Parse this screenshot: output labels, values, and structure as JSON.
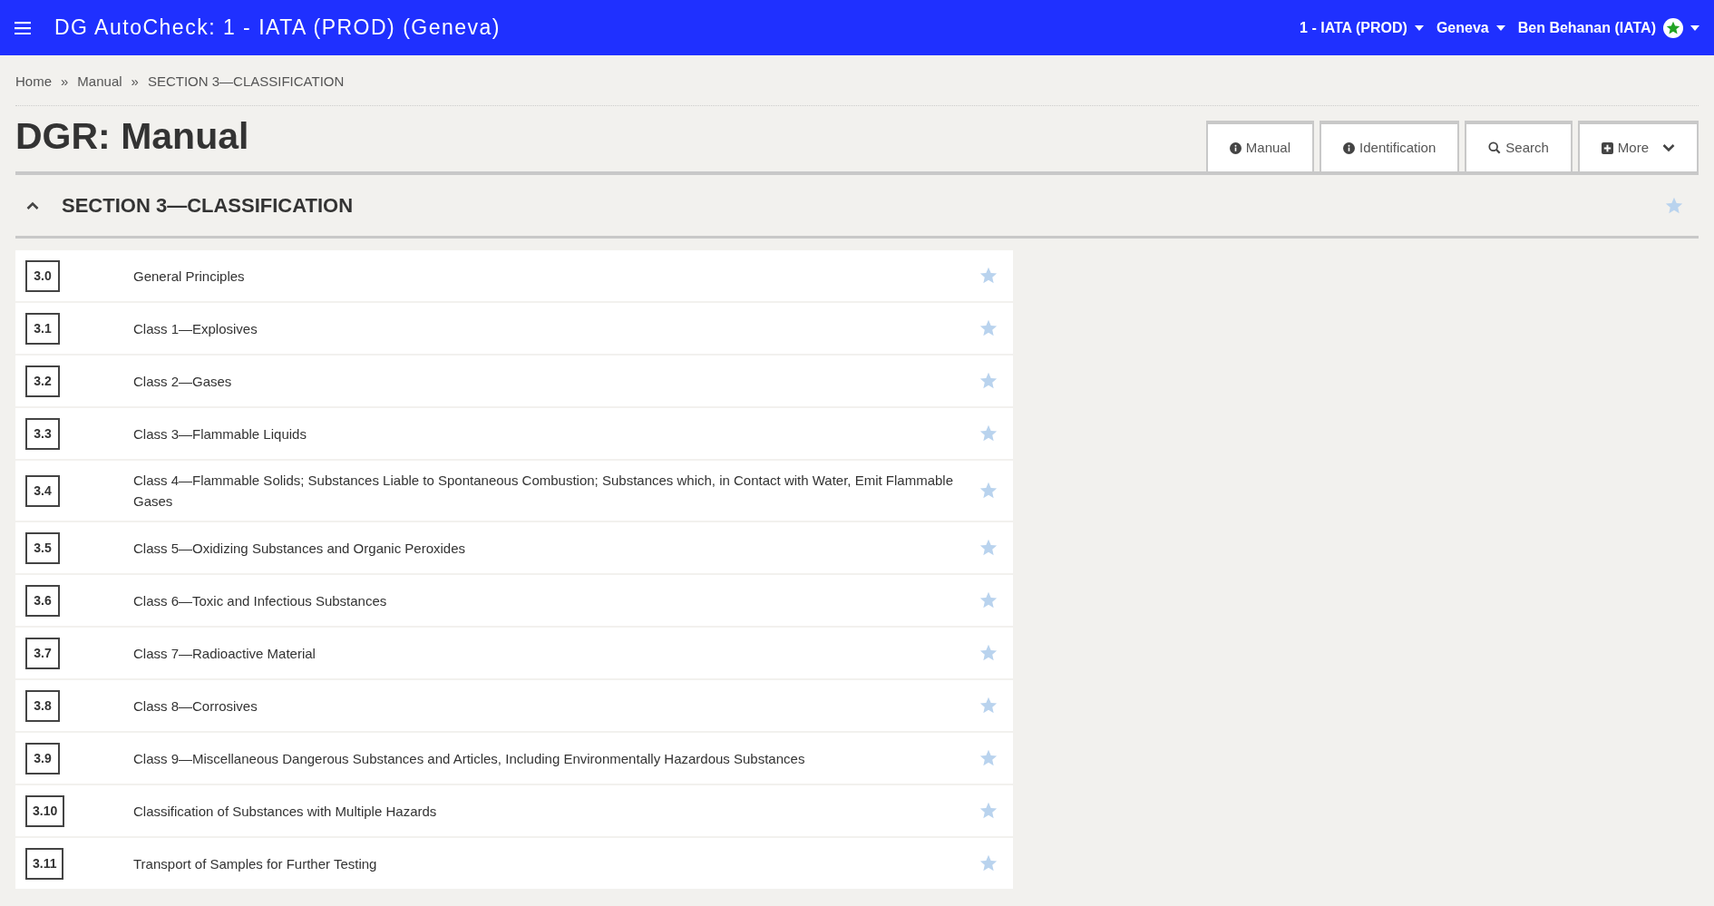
{
  "app_bar": {
    "title": "DG AutoCheck: 1 - IATA (PROD) (Geneva)",
    "menus": [
      {
        "label": "1 - IATA (PROD)"
      },
      {
        "label": "Geneva"
      },
      {
        "label": "Ben Behanan (IATA)",
        "kind": "user"
      }
    ]
  },
  "breadcrumb": [
    {
      "label": "Home"
    },
    {
      "separator": "»",
      "label": "Manual"
    },
    {
      "separator": "»",
      "label": "SECTION 3—CLASSIFICATION"
    }
  ],
  "page_title": "DGR: Manual",
  "tabs": [
    {
      "label": "Manual",
      "kind": "info"
    },
    {
      "label": "Identification",
      "kind": "info"
    },
    {
      "label": "Search",
      "kind": "search"
    },
    {
      "label": "More",
      "kind": "more"
    }
  ],
  "section": {
    "title": "SECTION 3—CLASSIFICATION",
    "expanded": true,
    "starred": false,
    "items": [
      {
        "number": "3.0",
        "title": "General Principles",
        "starred": false
      },
      {
        "number": "3.1",
        "title": "Class 1—Explosives",
        "starred": false
      },
      {
        "number": "3.2",
        "title": "Class 2—Gases",
        "starred": false
      },
      {
        "number": "3.3",
        "title": "Class 3—Flammable Liquids",
        "starred": false
      },
      {
        "number": "3.4",
        "title": "Class 4—Flammable Solids; Substances Liable to Spontaneous Combustion; Substances which, in Contact with Water, Emit Flammable Gases",
        "starred": false
      },
      {
        "number": "3.5",
        "title": "Class 5—Oxidizing Substances and Organic Peroxides",
        "starred": false
      },
      {
        "number": "3.6",
        "title": "Class 6—Toxic and Infectious Substances",
        "starred": false
      },
      {
        "number": "3.7",
        "title": "Class 7—Radioactive Material",
        "starred": false
      },
      {
        "number": "3.8",
        "title": "Class 8—Corrosives",
        "starred": false
      },
      {
        "number": "3.9",
        "title": "Class 9—Miscellaneous Dangerous Substances and Articles, Including Environmentally Hazardous Substances",
        "starred": false
      },
      {
        "number": "3.10",
        "title": "Classification of Substances with Multiple Hazards",
        "starred": false
      },
      {
        "number": "3.11",
        "title": "Transport of Samples for Further Testing",
        "starred": false
      }
    ]
  }
}
